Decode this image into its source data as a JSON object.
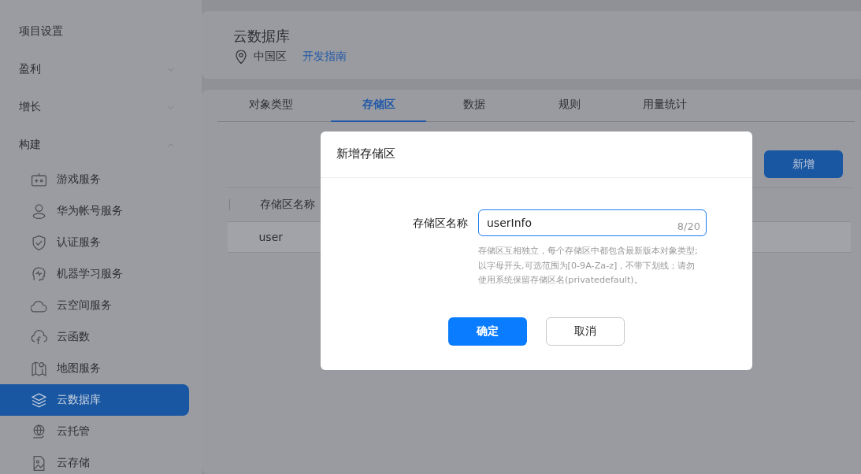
{
  "sidebar": {
    "items": [
      {
        "label": "项目设置",
        "kind": "link"
      },
      {
        "label": "盈利",
        "kind": "group",
        "expanded": false
      },
      {
        "label": "增长",
        "kind": "group",
        "expanded": false
      },
      {
        "label": "构建",
        "kind": "group",
        "expanded": true,
        "children": [
          {
            "label": "游戏服务",
            "selected": false
          },
          {
            "label": "华为帐号服务",
            "selected": false
          },
          {
            "label": "认证服务",
            "selected": false
          },
          {
            "label": "机器学习服务",
            "selected": false
          },
          {
            "label": "云空间服务",
            "selected": false
          },
          {
            "label": "云函数",
            "selected": false
          },
          {
            "label": "地图服务",
            "selected": false
          },
          {
            "label": "云数据库",
            "selected": true
          },
          {
            "label": "云托管",
            "selected": false
          },
          {
            "label": "云存储",
            "selected": false
          }
        ]
      }
    ]
  },
  "header": {
    "title": "云数据库",
    "region": "中国区",
    "guide_link": "开发指南"
  },
  "tabs": [
    {
      "label": "对象类型",
      "selected": false
    },
    {
      "label": "存储区",
      "selected": true
    },
    {
      "label": "数据",
      "selected": false
    },
    {
      "label": "规则",
      "selected": false
    },
    {
      "label": "用量统计",
      "selected": false
    }
  ],
  "add_button": "新增",
  "table": {
    "columns": [
      "存储区名称"
    ],
    "rows": [
      [
        "user"
      ]
    ]
  },
  "dialog": {
    "title": "新增存储区",
    "field": {
      "label": "存储区名称",
      "value": "userInfo",
      "counter": "8/20",
      "hint": "存储区互相独立，每个存储区中都包含最新版本对象类型;以字母开头,可选范围为[0-9A-Za-z]，不带下划线；请勿使用系统保留存储区名(privatedefault)。"
    },
    "buttons": [
      {
        "label": "确定",
        "kind": "primary"
      },
      {
        "label": "取消",
        "kind": "secondary"
      }
    ]
  }
}
